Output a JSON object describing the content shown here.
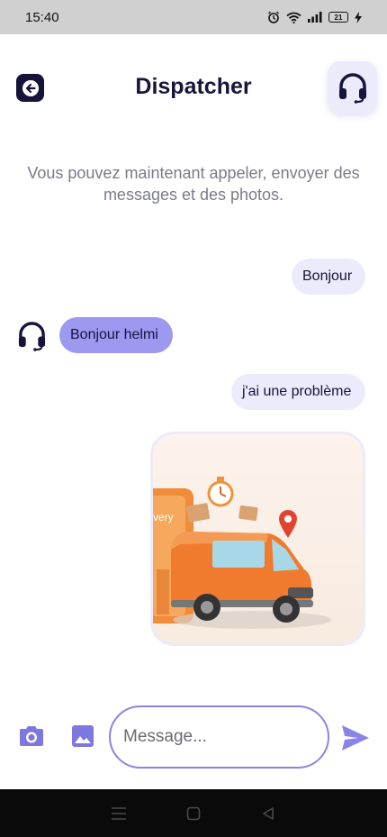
{
  "status_bar": {
    "time": "15:40",
    "battery_level": "21",
    "icons": [
      "alarm-icon",
      "wifi-icon",
      "signal-icon",
      "battery-icon",
      "charging-icon"
    ]
  },
  "header": {
    "title": "Dispatcher",
    "back_icon": "arrow-left-icon",
    "support_icon": "headset-icon"
  },
  "notice": "Vous pouvez maintenant appeler, envoyer des messages et des photos.",
  "messages": [
    {
      "direction": "outgoing",
      "text": "Bonjour"
    },
    {
      "direction": "incoming",
      "text": "Bonjour helmi",
      "avatar_icon": "headset-icon"
    },
    {
      "direction": "outgoing",
      "text": "j'ai une problème"
    },
    {
      "direction": "outgoing",
      "type": "image",
      "image_subject": "delivery van illustration",
      "image_text": "very"
    }
  ],
  "composer": {
    "placeholder": "Message...",
    "value": "",
    "camera_icon": "camera-icon",
    "gallery_icon": "image-icon",
    "send_icon": "send-icon"
  },
  "nav_bar": {
    "icons": [
      "menu-icon",
      "home-square-icon",
      "back-triangle-icon"
    ]
  },
  "colors": {
    "accent": "#8a84e6",
    "incoming_bubble": "#9d98f0",
    "outgoing_bubble": "#ecebfb",
    "dark": "#15143a",
    "status_bar_bg": "#d0d0d0"
  }
}
